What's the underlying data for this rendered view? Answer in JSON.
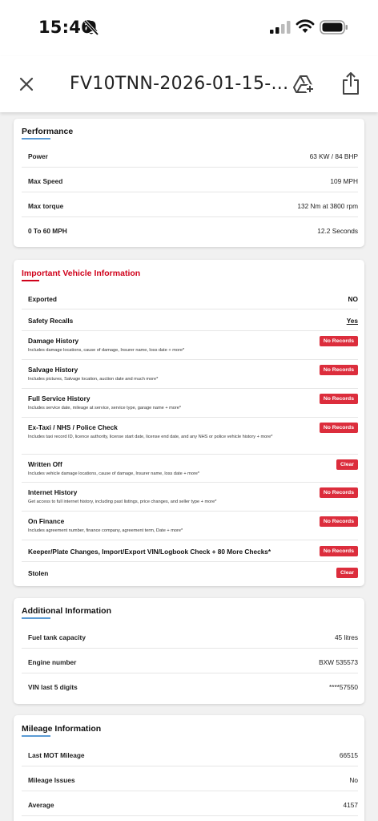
{
  "status": {
    "time": "15:46"
  },
  "header": {
    "title": "FV10TNN-2026-01-15-..."
  },
  "icons": {
    "bell": "bell-slash-icon",
    "signal": "cellular-signal-icon",
    "wifi": "wifi-icon",
    "battery": "battery-icon",
    "close": "close-icon",
    "drive": "add-to-drive-icon",
    "share": "share-icon"
  },
  "colors": {
    "accent_blue": "#5b9bd5",
    "accent_red": "#d0021b",
    "badge_red": "#dc2d3c"
  },
  "performance": {
    "title": "Performance",
    "rows": [
      {
        "label": "Power",
        "value": "63 KW / 84 BHP"
      },
      {
        "label": "Max Speed",
        "value": "109 MPH"
      },
      {
        "label": "Max torque",
        "value": "132 Nm at 3800 rpm"
      },
      {
        "label": "0 To 60 MPH",
        "value": "12.2 Seconds"
      }
    ]
  },
  "important": {
    "title": "Important Vehicle Information",
    "rows": [
      {
        "label": "Exported",
        "value": "NO"
      },
      {
        "label": "Safety Recalls",
        "value": "Yes"
      },
      {
        "label": "Damage History",
        "desc": "Includes damage locations, cause of damage, Insurer name, loss date + more*",
        "badge": "No Records"
      },
      {
        "label": "Salvage History",
        "desc": "Includes pictures, Salvage location, auction date and much more*",
        "badge": "No Records"
      },
      {
        "label": "Full Service History",
        "desc": "Includes service date, mileage at service, service type, garage name + more*",
        "badge": "No Records"
      },
      {
        "label": "Ex-Taxi / NHS / Police Check",
        "desc": "Includes taxi record ID, licence authority, license start date, license end date, and any NHS or police vehicle history + more*",
        "badge": "No Records"
      },
      {
        "label": "Written Off",
        "desc": "Includes vehicle damage locations, cause of damage, Insurer name, loss date + more*",
        "badge": "Clear"
      },
      {
        "label": "Internet History",
        "desc": "Get access to full internet history, including past listings, price changes, and seller type + more*",
        "badge": "No Records"
      },
      {
        "label": "On Finance",
        "desc": "Includes agreement number, finance company, agreement term, Date + more*",
        "badge": "No Records"
      },
      {
        "label": "Keeper/Plate Changes, Import/Export VIN/Logbook Check + 80 More Checks*",
        "badge": "No Records"
      },
      {
        "label": "Stolen",
        "badge": "Clear"
      }
    ]
  },
  "additional": {
    "title": "Additional Information",
    "rows": [
      {
        "label": "Fuel tank capacity",
        "value": "45 litres"
      },
      {
        "label": "Engine number",
        "value": "BXW 535573"
      },
      {
        "label": "VIN last 5 digits",
        "value": "****57550"
      }
    ]
  },
  "mileage": {
    "title": "Mileage Information",
    "rows": [
      {
        "label": "Last MOT Mileage",
        "value": "66515"
      },
      {
        "label": "Mileage Issues",
        "value": "No"
      },
      {
        "label": "Average",
        "value": "4157"
      }
    ]
  }
}
